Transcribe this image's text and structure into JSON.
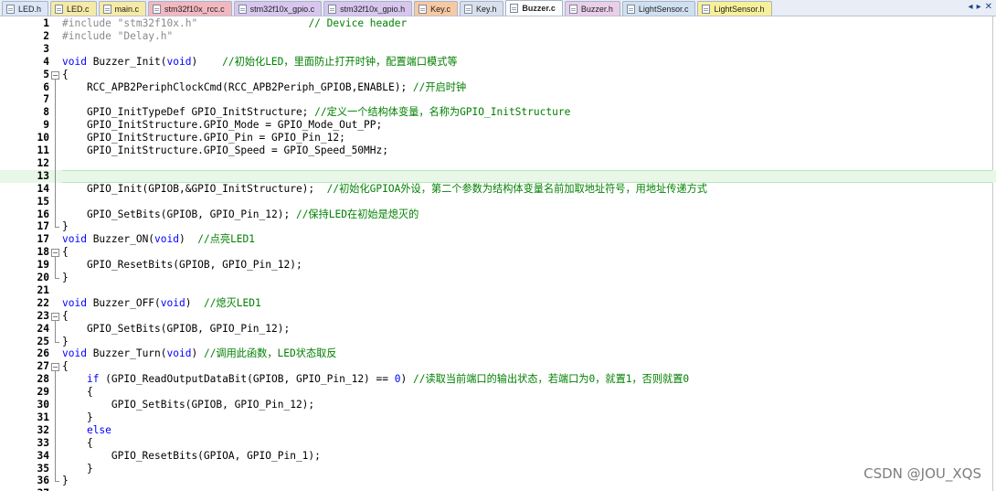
{
  "tabs": [
    {
      "label": "LED.h",
      "color": "#dbe6f7",
      "active": false
    },
    {
      "label": "LED.c",
      "color": "#f6eaa7",
      "active": false
    },
    {
      "label": "main.c",
      "color": "#f6eaa7",
      "active": false
    },
    {
      "label": "stm32f10x_rcc.c",
      "color": "#f2b8c0",
      "active": false
    },
    {
      "label": "stm32f10x_gpio.c",
      "color": "#d8c6ee",
      "active": false
    },
    {
      "label": "stm32f10x_gpio.h",
      "color": "#d8c6ee",
      "active": false
    },
    {
      "label": "Key.c",
      "color": "#f7c9a3",
      "active": false
    },
    {
      "label": "Key.h",
      "color": "#d8e0ee",
      "active": false
    },
    {
      "label": "Buzzer.c",
      "color": "#ffffff",
      "active": true
    },
    {
      "label": "Buzzer.h",
      "color": "#e9cfe9",
      "active": false
    },
    {
      "label": "LightSensor.c",
      "color": "#cfe0f0",
      "active": false
    },
    {
      "label": "LightSensor.h",
      "color": "#f7f09a",
      "active": false
    }
  ],
  "tab_nav": {
    "left_icon": "arrow-left-icon",
    "right_icon": "arrow-right-icon",
    "close_icon": "close-icon",
    "left": "◂",
    "right": "▸",
    "close": "✕"
  },
  "editor": {
    "current_line": 13,
    "lines": [
      {
        "n": "1",
        "fold": "none",
        "tokens": [
          [
            "pre",
            "#include "
          ],
          [
            "str",
            "\"stm32f10x.h\""
          ],
          [
            "plain",
            "                  "
          ],
          [
            "cmt",
            "// Device header"
          ]
        ]
      },
      {
        "n": "2",
        "fold": "none",
        "tokens": [
          [
            "pre",
            "#include "
          ],
          [
            "str",
            "\"Delay.h\""
          ]
        ]
      },
      {
        "n": "3",
        "fold": "none",
        "tokens": []
      },
      {
        "n": "4",
        "fold": "none",
        "tokens": [
          [
            "kw",
            "void"
          ],
          [
            "plain",
            " Buzzer_Init("
          ],
          [
            "kw",
            "void"
          ],
          [
            "plain",
            ")    "
          ],
          [
            "cmt",
            "//初始化LED，里面防止打开时钟，配置端口模式等"
          ]
        ]
      },
      {
        "n": "5",
        "fold": "open",
        "tokens": [
          [
            "plain",
            "{"
          ]
        ]
      },
      {
        "n": "6",
        "fold": "mid",
        "tokens": [
          [
            "plain",
            "    RCC_APB2PeriphClockCmd(RCC_APB2Periph_GPIOB,ENABLE); "
          ],
          [
            "cmt",
            "//开启时钟"
          ]
        ]
      },
      {
        "n": "7",
        "fold": "mid",
        "tokens": []
      },
      {
        "n": "8",
        "fold": "mid",
        "tokens": [
          [
            "plain",
            "    GPIO_InitTypeDef GPIO_InitStructure; "
          ],
          [
            "cmt",
            "//定义一个结构体变量，名称为GPIO_InitStructure"
          ]
        ]
      },
      {
        "n": "9",
        "fold": "mid",
        "tokens": [
          [
            "plain",
            "    GPIO_InitStructure.GPIO_Mode = GPIO_Mode_Out_PP;"
          ]
        ]
      },
      {
        "n": "10",
        "fold": "mid",
        "tokens": [
          [
            "plain",
            "    GPIO_InitStructure.GPIO_Pin = GPIO_Pin_12;"
          ]
        ]
      },
      {
        "n": "11",
        "fold": "mid",
        "tokens": [
          [
            "plain",
            "    GPIO_InitStructure.GPIO_Speed = GPIO_Speed_50MHz;"
          ]
        ]
      },
      {
        "n": "12",
        "fold": "mid",
        "tokens": []
      },
      {
        "n": "13",
        "fold": "mid",
        "tokens": []
      },
      {
        "n": "14",
        "fold": "mid",
        "tokens": [
          [
            "plain",
            "    GPIO_Init(GPIOB,&GPIO_InitStructure);  "
          ],
          [
            "cmt",
            "//初始化GPIOA外设，第二个参数为结构体变量名前加取地址符号，用地址传递方式"
          ]
        ]
      },
      {
        "n": "15",
        "fold": "mid",
        "tokens": []
      },
      {
        "n": "16",
        "fold": "mid",
        "tokens": [
          [
            "plain",
            "    GPIO_SetBits(GPIOB, GPIO_Pin_12); "
          ],
          [
            "cmt",
            "//保持LED在初始是熄灭的"
          ]
        ]
      },
      {
        "n": "17",
        "fold": "end",
        "tokens": [
          [
            "plain",
            "}"
          ]
        ]
      },
      {
        "n": "17",
        "fold": "none",
        "tokens": [
          [
            "kw",
            "void"
          ],
          [
            "plain",
            " Buzzer_ON("
          ],
          [
            "kw",
            "void"
          ],
          [
            "plain",
            ")  "
          ],
          [
            "cmt",
            "//点亮LED1"
          ]
        ]
      },
      {
        "n": "18",
        "fold": "open",
        "tokens": [
          [
            "plain",
            "{"
          ]
        ]
      },
      {
        "n": "19",
        "fold": "mid",
        "tokens": [
          [
            "plain",
            "    GPIO_ResetBits(GPIOB, GPIO_Pin_12);"
          ]
        ]
      },
      {
        "n": "20",
        "fold": "end",
        "tokens": [
          [
            "plain",
            "}"
          ]
        ]
      },
      {
        "n": "21",
        "fold": "none",
        "tokens": []
      },
      {
        "n": "22",
        "fold": "none",
        "tokens": [
          [
            "kw",
            "void"
          ],
          [
            "plain",
            " Buzzer_OFF("
          ],
          [
            "kw",
            "void"
          ],
          [
            "plain",
            ")  "
          ],
          [
            "cmt",
            "//熄灭LED1"
          ]
        ]
      },
      {
        "n": "23",
        "fold": "open",
        "tokens": [
          [
            "plain",
            "{"
          ]
        ]
      },
      {
        "n": "24",
        "fold": "mid",
        "tokens": [
          [
            "plain",
            "    GPIO_SetBits(GPIOB, GPIO_Pin_12);"
          ]
        ]
      },
      {
        "n": "25",
        "fold": "end",
        "tokens": [
          [
            "plain",
            "}"
          ]
        ]
      },
      {
        "n": "26",
        "fold": "none",
        "tokens": [
          [
            "kw",
            "void"
          ],
          [
            "plain",
            " Buzzer_Turn("
          ],
          [
            "kw",
            "void"
          ],
          [
            "plain",
            ") "
          ],
          [
            "cmt",
            "//调用此函数，LED状态取反"
          ]
        ]
      },
      {
        "n": "27",
        "fold": "open",
        "tokens": [
          [
            "plain",
            "{"
          ]
        ]
      },
      {
        "n": "28",
        "fold": "mid",
        "tokens": [
          [
            "plain",
            "    "
          ],
          [
            "kw",
            "if"
          ],
          [
            "plain",
            " (GPIO_ReadOutputDataBit(GPIOB, GPIO_Pin_12) == "
          ],
          [
            "num",
            "0"
          ],
          [
            "plain",
            ") "
          ],
          [
            "cmt",
            "//读取当前端口的输出状态，若端口为0，就置1，否则就置0"
          ]
        ]
      },
      {
        "n": "29",
        "fold": "mid",
        "tokens": [
          [
            "plain",
            "    {"
          ]
        ]
      },
      {
        "n": "30",
        "fold": "mid",
        "tokens": [
          [
            "plain",
            "        GPIO_SetBits(GPIOB, GPIO_Pin_12);"
          ]
        ]
      },
      {
        "n": "31",
        "fold": "mid",
        "tokens": [
          [
            "plain",
            "    }"
          ]
        ]
      },
      {
        "n": "32",
        "fold": "mid",
        "tokens": [
          [
            "plain",
            "    "
          ],
          [
            "kw",
            "else"
          ]
        ]
      },
      {
        "n": "33",
        "fold": "mid",
        "tokens": [
          [
            "plain",
            "    {"
          ]
        ]
      },
      {
        "n": "34",
        "fold": "mid",
        "tokens": [
          [
            "plain",
            "        GPIO_ResetBits(GPIOA, GPIO_Pin_1);"
          ]
        ]
      },
      {
        "n": "35",
        "fold": "mid",
        "tokens": [
          [
            "plain",
            "    }"
          ]
        ]
      },
      {
        "n": "36",
        "fold": "end",
        "tokens": [
          [
            "plain",
            "}"
          ]
        ]
      },
      {
        "n": "37",
        "fold": "none",
        "tokens": []
      }
    ]
  },
  "watermark": "CSDN @JOU_XQS"
}
